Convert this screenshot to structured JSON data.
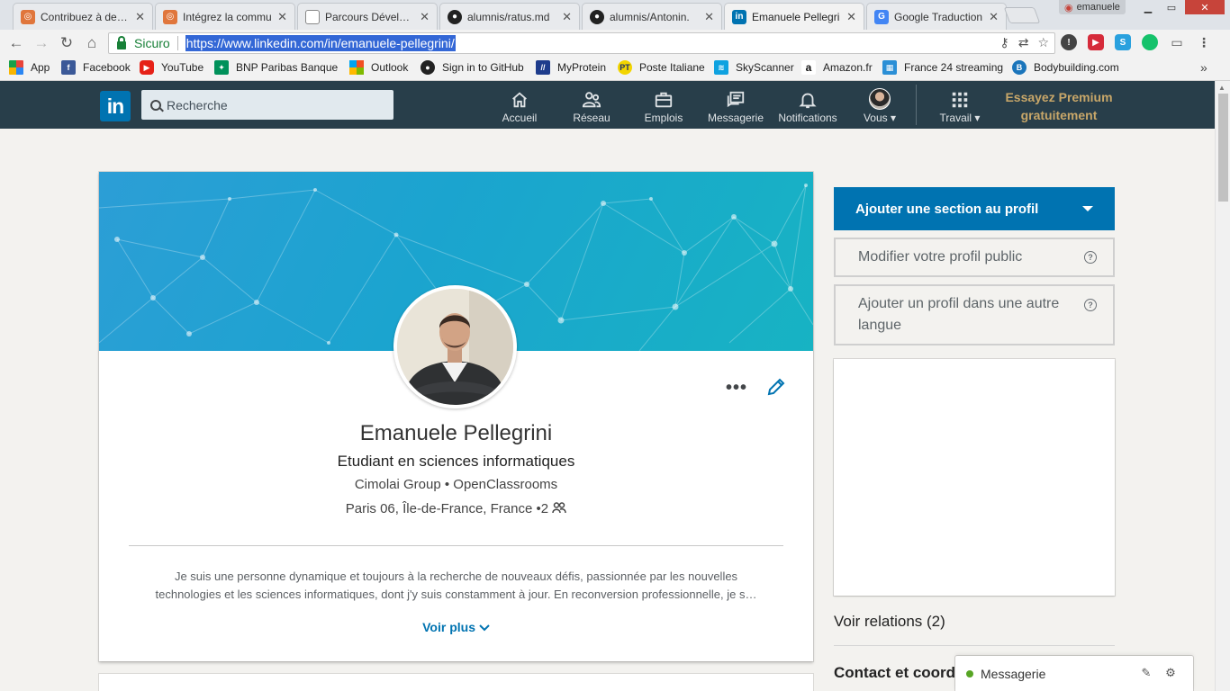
{
  "browser": {
    "tabs": [
      {
        "title": "Contribuez à des p",
        "icon": "openclassrooms-icon",
        "color": "#e0763c"
      },
      {
        "title": "Intégrez la commu",
        "icon": "openclassrooms-icon",
        "color": "#e0763c"
      },
      {
        "title": "Parcours Développ",
        "icon": "document-icon",
        "color": "#888888"
      },
      {
        "title": "alumnis/ratus.md",
        "icon": "github-icon",
        "color": "#222222"
      },
      {
        "title": "alumnis/Antonin.",
        "icon": "github-icon",
        "color": "#222222"
      },
      {
        "title": "Emanuele Pellegri",
        "icon": "linkedin-icon",
        "color": "#0073b1",
        "active": true
      },
      {
        "title": "Google Traduction",
        "icon": "google-translate-icon",
        "color": "#4285f4"
      }
    ],
    "profile_name": "emanuele",
    "secure_label": "Sicuro",
    "url": "https://www.linkedin.com/in/emanuele-pellegrini/",
    "bookmarks": [
      {
        "label": "App",
        "icon": "apps-grid-icon",
        "color": "#e8443a"
      },
      {
        "label": "Facebook",
        "icon": "facebook-icon",
        "color": "#3b5998"
      },
      {
        "label": "YouTube",
        "icon": "youtube-icon",
        "color": "#e62117"
      },
      {
        "label": "BNP Paribas Banque",
        "icon": "bnp-icon",
        "color": "#00915a"
      },
      {
        "label": "Outlook",
        "icon": "outlook-icon",
        "color": "#f25022"
      },
      {
        "label": "Sign in to GitHub",
        "icon": "github-icon",
        "color": "#222222"
      },
      {
        "label": "MyProtein",
        "icon": "myprotein-icon",
        "color": "#1e3c8c"
      },
      {
        "label": "Poste Italiane",
        "icon": "poste-italiane-icon",
        "color": "#f3d500"
      },
      {
        "label": "SkyScanner",
        "icon": "skyscanner-icon",
        "color": "#0fa2e0"
      },
      {
        "label": "Amazon.fr",
        "icon": "amazon-icon",
        "color": "#111111"
      },
      {
        "label": "France 24 streaming",
        "icon": "france24-icon",
        "color": "#2b8fd6"
      },
      {
        "label": "Bodybuilding.com",
        "icon": "bodybuilding-icon",
        "color": "#1b75bb"
      }
    ]
  },
  "linkedin": {
    "search_placeholder": "Recherche",
    "nav": [
      {
        "label": "Accueil",
        "icon": "home-icon"
      },
      {
        "label": "Réseau",
        "icon": "network-icon"
      },
      {
        "label": "Emplois",
        "icon": "jobs-briefcase-icon"
      },
      {
        "label": "Messagerie",
        "icon": "messaging-icon"
      },
      {
        "label": "Notifications",
        "icon": "bell-icon"
      },
      {
        "label": "Vous ▾",
        "icon": "avatar"
      },
      {
        "label": "Travail ▾",
        "icon": "grid-icon"
      }
    ],
    "premium": {
      "line1": "Essayez Premium",
      "line2": "gratuitement"
    }
  },
  "profile": {
    "name": "Emanuele Pellegrini",
    "headline": "Etudiant en sciences informatiques",
    "company": "Cimolai Group • OpenClassrooms",
    "location": "Paris 06, Île-de-France, France",
    "connections_badge": "•2",
    "summary_line1": "Je suis une personne dynamique et toujours à la recherche de nouveaux défis, passionnée par les nouvelles",
    "summary_line2": "technologies et les sciences informatiques, dont j'y suis constamment à jour. En reconversion professionnelle, je s…",
    "see_more": "Voir plus"
  },
  "rail": {
    "add_section": "Ajouter une section au profil",
    "edit_public": "Modifier votre profil public",
    "other_language": "Ajouter un profil dans une autre langue",
    "connections": "Voir relations (2)",
    "contact": "Contact et coord"
  },
  "messaging": {
    "label": "Messagerie"
  }
}
